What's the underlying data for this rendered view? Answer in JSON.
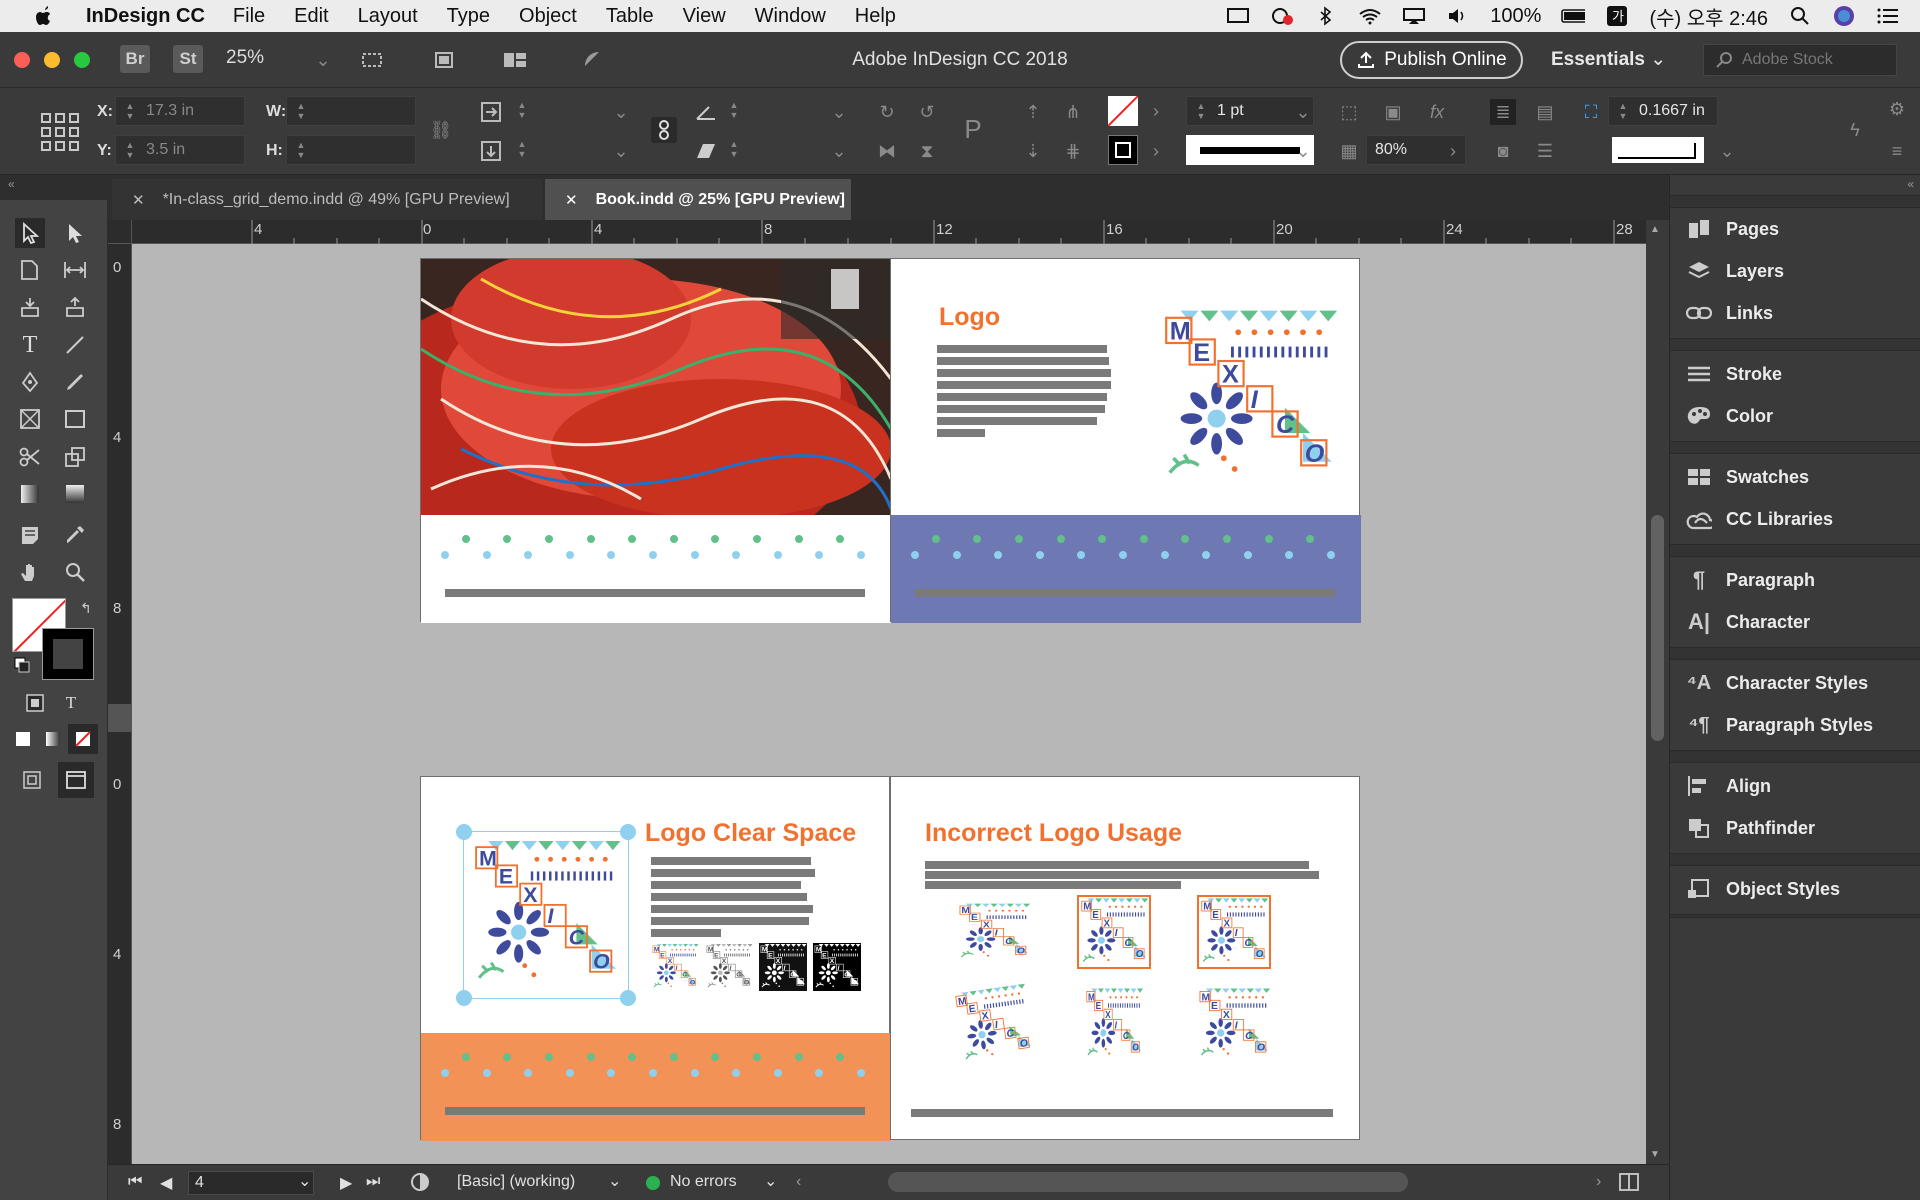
{
  "menubar": {
    "app_name": "InDesign CC",
    "items": [
      "File",
      "Edit",
      "Layout",
      "Type",
      "Object",
      "Table",
      "View",
      "Window",
      "Help"
    ],
    "battery": "100%",
    "clock": "(수) 오후 2:46"
  },
  "titlebar": {
    "bridge_label": "Br",
    "stock_label": "St",
    "zoom": "25%",
    "window_title": "Adobe InDesign CC 2018",
    "publish_label": "Publish Online",
    "workspace": "Essentials",
    "search_placeholder": "Adobe Stock"
  },
  "control_panel": {
    "x_label": "X:",
    "x_value": "17.3 in",
    "y_label": "Y:",
    "y_value": "3.5 in",
    "w_label": "W:",
    "h_label": "H:",
    "stroke_weight": "1 pt",
    "opacity": "80%",
    "gutter": "0.1667 in"
  },
  "tabs": [
    {
      "label": "*In-class_grid_demo.indd @ 49% [GPU Preview]",
      "active": false
    },
    {
      "label": "Book.indd @ 25% [GPU Preview]",
      "active": true
    }
  ],
  "rulers": {
    "horizontal": [
      "4",
      "0",
      "4",
      "8",
      "12",
      "16",
      "20",
      "24",
      "28"
    ],
    "vertical": [
      "0",
      "4",
      "8",
      "0",
      "4",
      "8"
    ]
  },
  "pages": {
    "logo_heading": "Logo",
    "clear_space_heading": "Logo Clear Space",
    "incorrect_heading": "Incorrect Logo Usage",
    "logo_letters": [
      "M",
      "E",
      "X",
      "I",
      "C",
      "O"
    ]
  },
  "status": {
    "page_number": "4",
    "style": "[Basic] (working)",
    "preflight": "No errors"
  },
  "dock": {
    "groups": [
      [
        "Pages",
        "Layers",
        "Links"
      ],
      [
        "Stroke",
        "Color"
      ],
      [
        "Swatches",
        "CC Libraries"
      ],
      [
        "Paragraph",
        "Character"
      ],
      [
        "Character Styles",
        "Paragraph Styles"
      ],
      [
        "Align",
        "Pathfinder"
      ],
      [
        "Object Styles"
      ]
    ]
  },
  "colors": {
    "accent_orange": "#f2712f",
    "purple_band": "#6e78b3",
    "orange_band": "#f39257",
    "logo_blue": "#3e4a9c",
    "logo_green": "#62c08a",
    "logo_lightblue": "#8fd0ee"
  }
}
